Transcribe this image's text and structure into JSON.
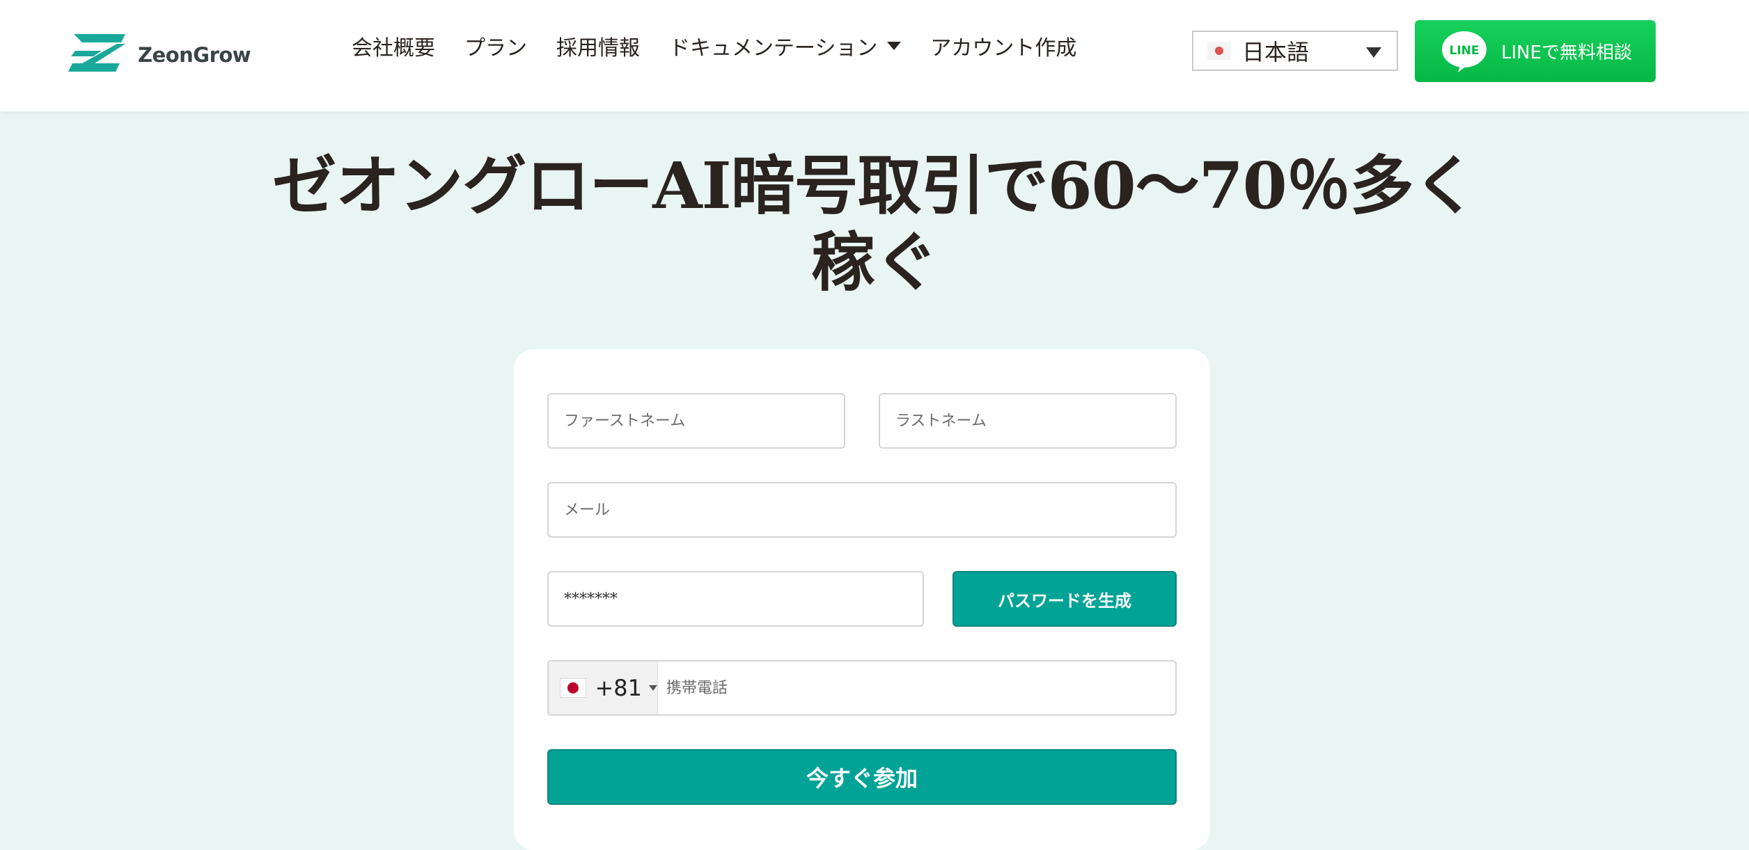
{
  "brand": {
    "name": "ZeonGrow",
    "logo_color": "#1aa89b"
  },
  "nav": {
    "items": [
      {
        "label": "会社概要"
      },
      {
        "label": "プラン"
      },
      {
        "label": "採用情報"
      },
      {
        "label": "ドキュメンテーション",
        "has_dropdown": true
      },
      {
        "label": "アカウント作成"
      }
    ]
  },
  "language": {
    "selected": "日本語",
    "flag_icon": "japan-flag-icon"
  },
  "line_button": {
    "icon_text": "LINE",
    "label": "LINEで無料相談",
    "color": "#06c755"
  },
  "hero": {
    "headline_line1": "ゼオングローAI暗号取引で60～70％多く",
    "headline_line2": "稼ぐ"
  },
  "form": {
    "first_name_placeholder": "ファーストネーム",
    "last_name_placeholder": "ラストネーム",
    "email_placeholder": "メール",
    "password_value": "*******",
    "generate_password_label": "パスワードを生成",
    "phone": {
      "country_code": "+81",
      "flag_icon": "japan-flag-icon",
      "placeholder": "携帯電話"
    },
    "submit_label": "今すぐ参加",
    "accent_color": "#00a396"
  },
  "colors": {
    "page_background": "#e9f5f3",
    "header_background": "#ffffff"
  }
}
